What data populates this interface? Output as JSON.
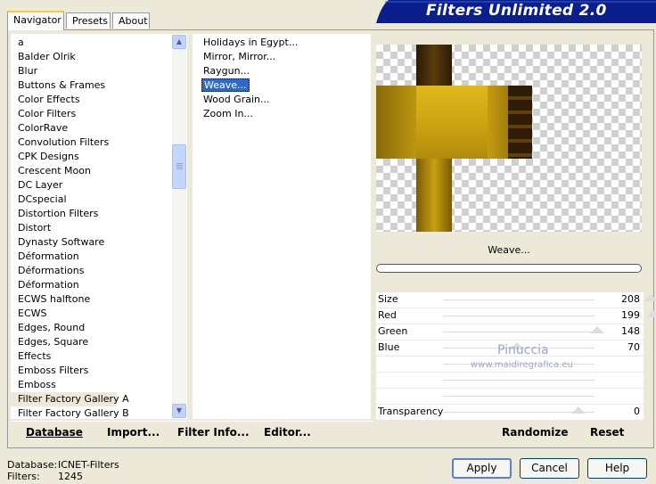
{
  "tabs": [
    "Navigator",
    "Presets",
    "About"
  ],
  "banner": "Filters Unlimited 2.0",
  "categories": [
    "a",
    "Balder Olrik",
    "Blur",
    "Buttons & Frames",
    "Color Effects",
    "Color Filters",
    "ColorRave",
    "Convolution Filters",
    "CPK Designs",
    "Crescent Moon",
    "DC Layer",
    "DCspecial",
    "Distortion Filters",
    "Distort",
    "Dynasty Software",
    "Déformation",
    "Déformations",
    "Déformation",
    "ECWS halftone",
    "ECWS",
    "Edges, Round",
    "Edges, Square",
    "Effects",
    "Emboss Filters",
    "Emboss",
    "Filter Factory Gallery A",
    "Filter Factory Gallery B"
  ],
  "filters": [
    "Holidays in Egypt...",
    "Mirror, Mirror...",
    "Raygun...",
    "Weave...",
    "Wood Grain...",
    "Zoom In..."
  ],
  "selected_filter_index": 3,
  "selected_category": "Filter Factory Gallery A",
  "filter_name": "Weave...",
  "params": [
    {
      "label": "Size",
      "value": "208"
    },
    {
      "label": "Red",
      "value": "199"
    },
    {
      "label": "Green",
      "value": "148"
    },
    {
      "label": "Blue",
      "value": "70"
    },
    {
      "label": "",
      "value": ""
    },
    {
      "label": "",
      "value": ""
    },
    {
      "label": "",
      "value": ""
    },
    {
      "label": "Transparency",
      "value": "0"
    }
  ],
  "watermark": {
    "name": "Pinuccia",
    "url": "www.maidiregrafica.eu"
  },
  "links": {
    "database": "Database",
    "import": "Import...",
    "filter_info": "Filter Info...",
    "editor": "Editor...",
    "randomize": "Randomize",
    "reset": "Reset"
  },
  "status": {
    "database_label": "Database:",
    "database_value": "ICNET-Filters",
    "filters_label": "Filters:",
    "filters_value": "1245"
  },
  "buttons": {
    "apply": "Apply",
    "cancel": "Cancel",
    "help": "Help"
  },
  "colors": {
    "banner": "#0a1f8c",
    "selection": "#316ac5",
    "weave_gold": "#c9a012",
    "weave_dark": "#3a2408"
  }
}
